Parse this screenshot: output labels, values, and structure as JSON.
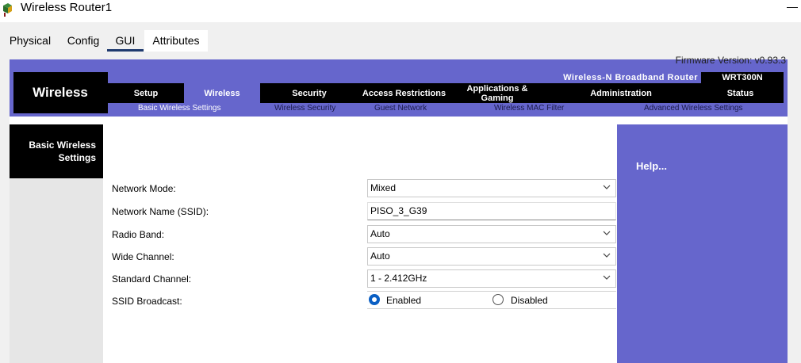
{
  "window": {
    "title": "Wireless Router1",
    "minimize_glyph": "—",
    "icon": "router-icon"
  },
  "tabs": [
    {
      "label": "Physical"
    },
    {
      "label": "Config"
    },
    {
      "label": "GUI",
      "active": true
    },
    {
      "label": "Attributes"
    }
  ],
  "header": {
    "firmware_text": "Firmware Version: v0.93.3",
    "brand": "Wireless",
    "router_name": "Wireless-N Broadband Router",
    "router_model": "WRT300N",
    "nav": [
      {
        "label": "Setup"
      },
      {
        "label": "Wireless",
        "active": true
      },
      {
        "label": "Security"
      },
      {
        "label": "Access Restrictions"
      },
      {
        "label": "Applications & Gaming"
      },
      {
        "label": "Administration"
      },
      {
        "label": "Status"
      }
    ],
    "subnav": [
      {
        "label": "Basic Wireless Settings"
      },
      {
        "label": "Wireless Security"
      },
      {
        "label": "Guest Network"
      },
      {
        "label": "Wireless MAC Filter"
      },
      {
        "label": "Advanced Wireless Settings"
      }
    ]
  },
  "sidebar": {
    "title": "Basic Wireless Settings"
  },
  "form": {
    "network_mode": {
      "label": "Network Mode:",
      "value": "Mixed"
    },
    "ssid": {
      "label": "Network Name (SSID):",
      "value": "PISO_3_G39"
    },
    "radio_band": {
      "label": "Radio Band:",
      "value": "Auto"
    },
    "wide_channel": {
      "label": "Wide Channel:",
      "value": "Auto"
    },
    "standard_channel": {
      "label": "Standard Channel:",
      "value": "1 - 2.412GHz"
    },
    "ssid_broadcast": {
      "label": "SSID Broadcast:",
      "enabled_label": "Enabled",
      "disabled_label": "Disabled",
      "selected": "Enabled"
    }
  },
  "help": {
    "label": "Help..."
  },
  "colors": {
    "accent": "#6666cc",
    "header_black": "#000000",
    "radio_selected": "#0a5fc4",
    "tab_underline": "#1f3a6e"
  }
}
